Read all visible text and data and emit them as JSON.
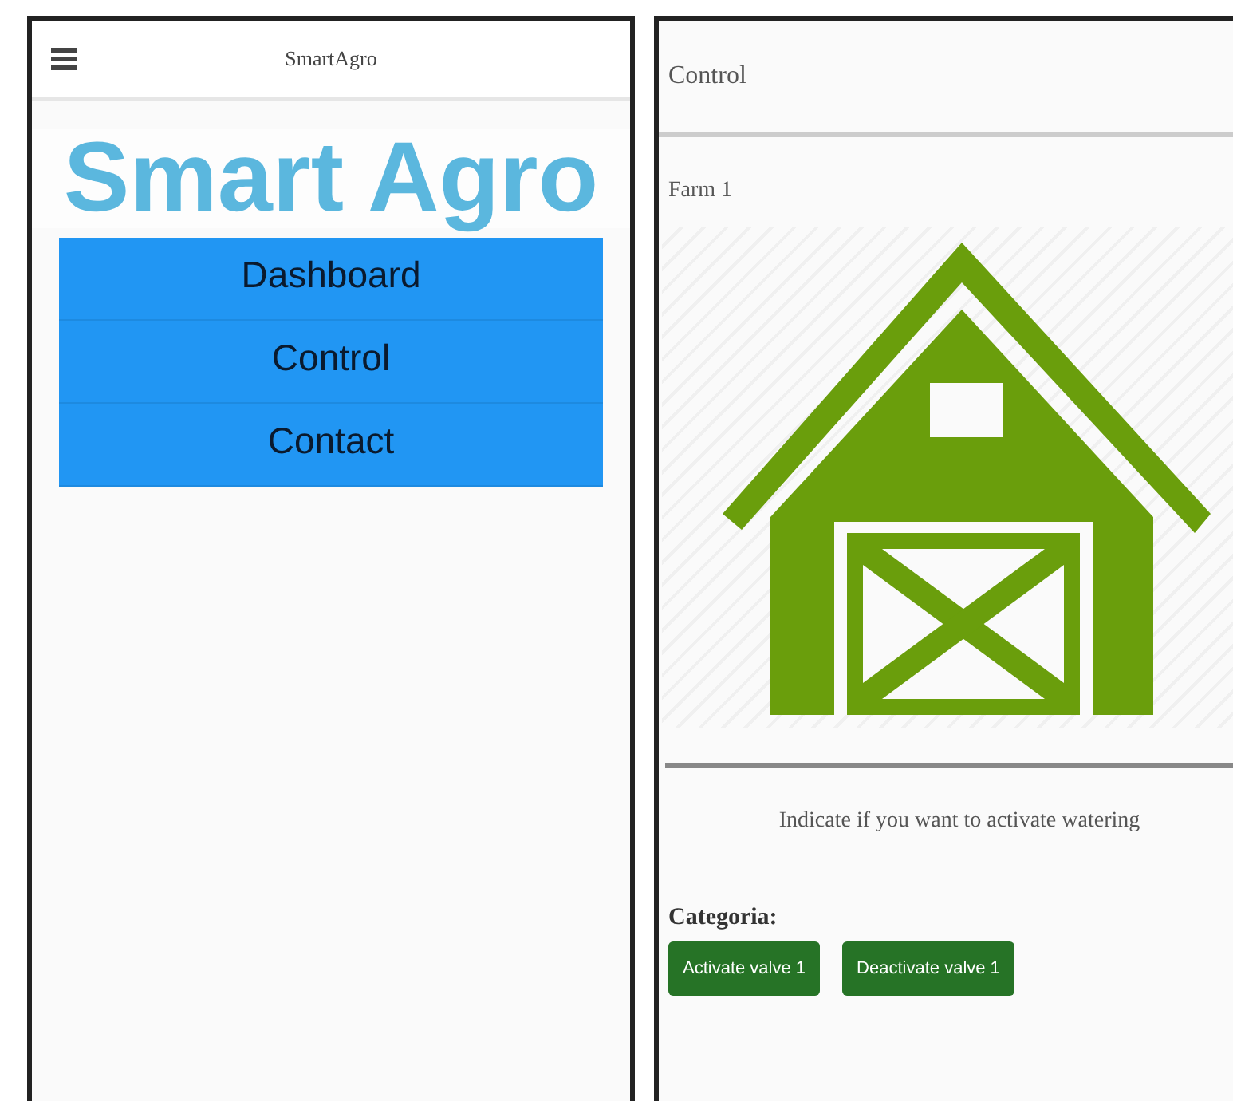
{
  "left_screen": {
    "app_bar": {
      "title": "SmartAgro"
    },
    "heading": "Smart Agro",
    "menu": [
      {
        "label": "Dashboard"
      },
      {
        "label": "Control"
      },
      {
        "label": "Contact"
      }
    ]
  },
  "right_screen": {
    "header": {
      "title": "Control"
    },
    "farm_label": "Farm 1",
    "instruction": "Indicate if you want to activate watering",
    "category_label": "Categoria:",
    "buttons": [
      {
        "label": "Activate valve 1"
      },
      {
        "label": "Deactivate valve 1"
      }
    ]
  }
}
